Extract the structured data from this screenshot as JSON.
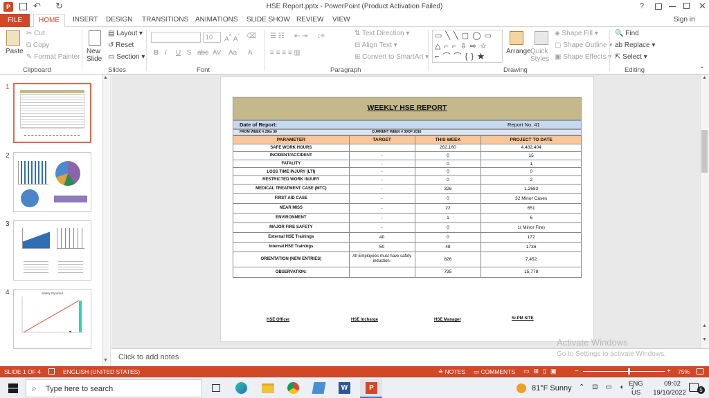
{
  "title_bar": {
    "title": "HSE Report.pptx - PowerPoint (Product Activation Failed)",
    "help": "?",
    "sign_in": "Sign in"
  },
  "tabs": [
    "FILE",
    "HOME",
    "INSERT",
    "DESIGN",
    "TRANSITIONS",
    "ANIMATIONS",
    "SLIDE SHOW",
    "REVIEW",
    "VIEW"
  ],
  "ribbon": {
    "clipboard": {
      "paste": "Paste",
      "cut": "Cut",
      "copy": "Copy",
      "format_painter": "Format Painter",
      "label": "Clipboard"
    },
    "slides": {
      "new_slide": "New Slide",
      "layout": "Layout",
      "reset": "Reset",
      "section": "Section",
      "label": "Slides"
    },
    "font": {
      "size": "10",
      "label": "Font"
    },
    "paragraph": {
      "text_direction": "Text Direction",
      "align_text": "Align Text",
      "convert_smartart": "Convert to SmartArt",
      "label": "Paragraph"
    },
    "drawing": {
      "arrange": "Arrange",
      "quick_styles": "Quick Styles",
      "shape_fill": "Shape Fill",
      "shape_outline": "Shape Outline",
      "shape_effects": "Shape Effects",
      "label": "Drawing"
    },
    "editing": {
      "find": "Find",
      "replace": "Replace",
      "select": "Select",
      "label": "Editing"
    }
  },
  "thumbnails": [
    "1",
    "2",
    "3",
    "4"
  ],
  "thumb4_title": "Safety Pyramid",
  "report": {
    "title": "WEEKLY HSE REPORT",
    "date_label": "Date of Report:",
    "report_no": "Report No. 41",
    "from_week": "FROM WEEK # 29to 30",
    "current_week": "CURRENT WEEK # 30OF 2016",
    "headers": [
      "PARAMETER",
      "TARGET",
      "THIS WEEK",
      "PROJECT TO DATE"
    ],
    "rows": [
      [
        "SAFE WORK HOURS",
        "",
        "262,160",
        "4,482,404"
      ],
      [
        "INCIDENT/ACCIDENT",
        "-",
        "0",
        "15"
      ],
      [
        "FATALITY",
        "-",
        "0",
        "1"
      ],
      [
        "LOSS TIME INJURY (LTI)",
        "-",
        "0",
        "0"
      ],
      [
        "RESTRICTED WORK INJURY",
        "-",
        "0",
        "2"
      ],
      [
        "MEDICAL TREATMENT CASE (MTC)",
        "-",
        "326",
        "1,2683"
      ],
      [
        "FIRST AID CASE",
        "-",
        "0",
        "32 Minor Cases"
      ],
      [
        "NEAR MISS",
        "-",
        "22",
        "651"
      ],
      [
        "ENVIRONMENT",
        "-",
        "1",
        "6"
      ],
      [
        "MAJOR FIRE SAFETY",
        "-",
        "0",
        "1( Minor Fire)"
      ],
      [
        "External HSE Trainings",
        "40",
        "0",
        "172"
      ],
      [
        "Internal HSE Trainings",
        "50",
        "48",
        "1736"
      ],
      [
        "ORIENTATION (NEW ENTRIES)",
        "All Employees must have safety induction.",
        "826",
        "7,452"
      ],
      [
        "OBSERVATION:",
        "",
        "735",
        "15,778"
      ]
    ],
    "signatures": [
      "HSE Officer",
      "HSE Incharge",
      "HSE Manager",
      "Sr.PM SITE"
    ]
  },
  "notes_placeholder": "Click to add notes",
  "watermark": {
    "line1": "Activate Windows",
    "line2": "Go to Settings to activate Windows."
  },
  "status": {
    "slide": "SLIDE 1 OF 4",
    "language": "ENGLISH (UNITED STATES)",
    "notes": "NOTES",
    "comments": "COMMENTS",
    "zoom": "75%"
  },
  "taskbar": {
    "search": "Type here to search",
    "weather": "81°F  Sunny",
    "lang1": "ENG",
    "lang2": "US",
    "time": "09:02",
    "date": "19/10/2022",
    "notif": "5"
  },
  "colors": {
    "accent": "#d24726",
    "title_band": "#c4b98b",
    "date_band": "#c5d9f1",
    "header_row": "#f9c79a"
  }
}
